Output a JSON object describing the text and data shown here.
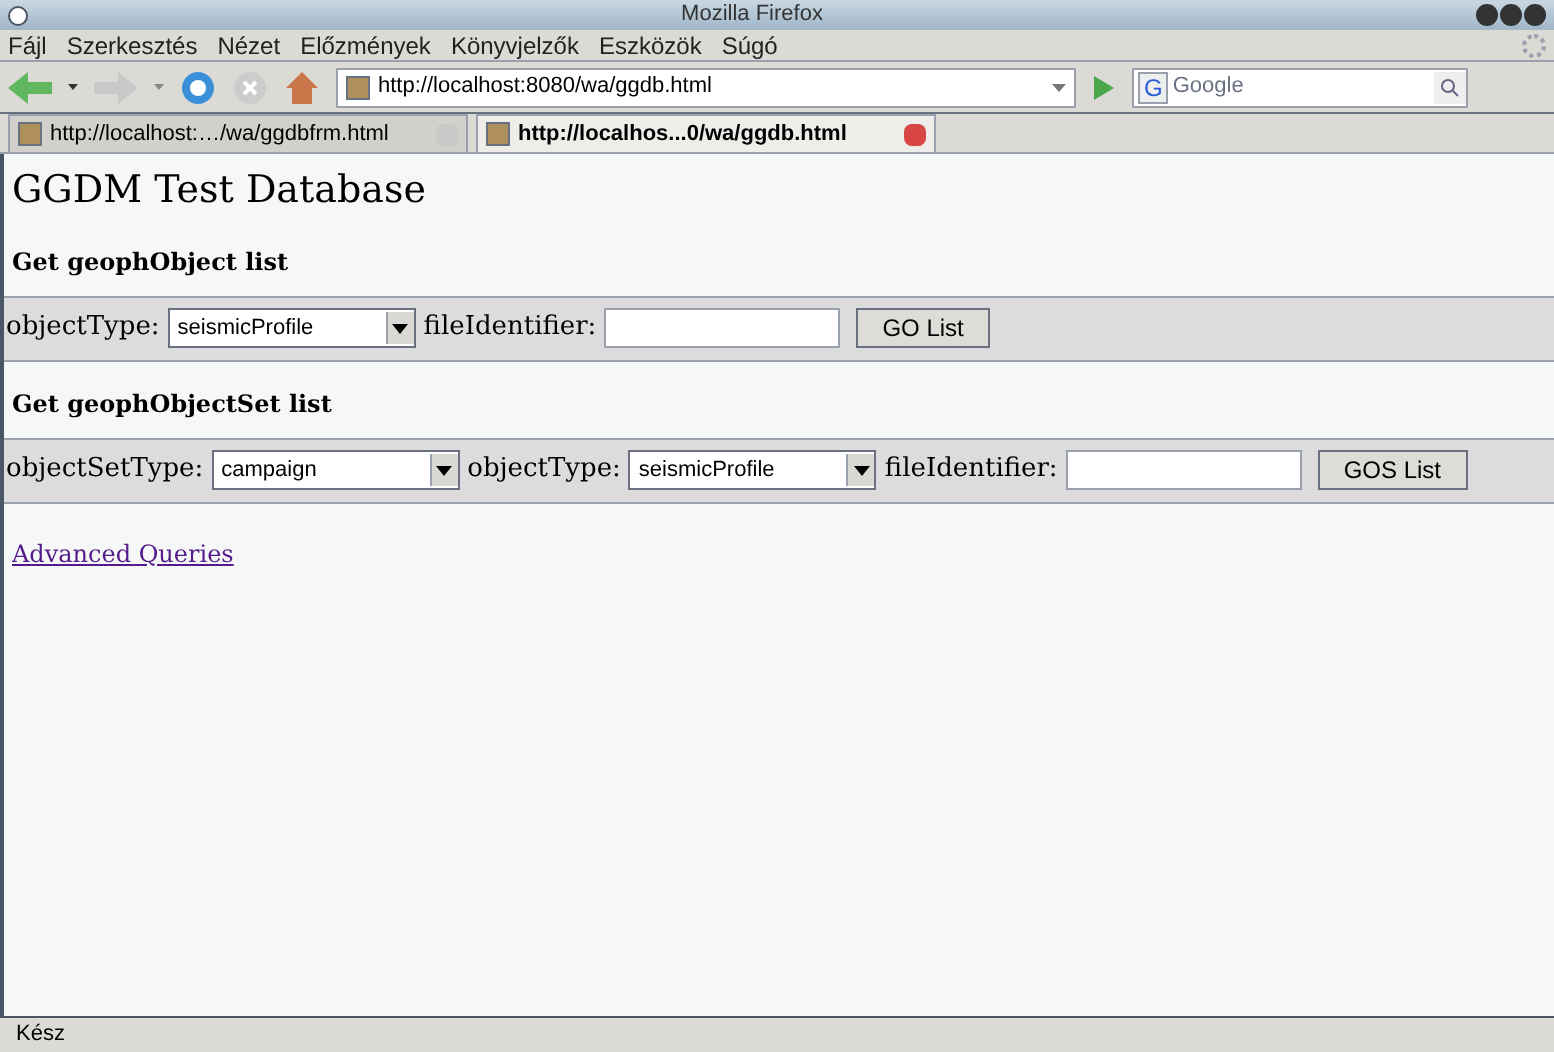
{
  "window": {
    "title": "Mozilla Firefox"
  },
  "menu": [
    "Fájl",
    "Szerkesztés",
    "Nézet",
    "Előzmények",
    "Könyvjelzők",
    "Eszközök",
    "Súgó"
  ],
  "address_bar": {
    "value": "http://localhost:8080/wa/ggdb.html"
  },
  "search": {
    "placeholder": "Google",
    "engine_label": "G"
  },
  "tabs": [
    {
      "label": "http://localhost:…/wa/ggdbfrm.html",
      "selected": false
    },
    {
      "label": "http://localhos...0/wa/ggdb.html",
      "selected": true
    }
  ],
  "page": {
    "title": "GGDM Test Database",
    "sections": [
      {
        "heading": "Get geophObject list",
        "fields": [
          {
            "kind": "select",
            "label": "objectType:",
            "value": "seismicProfile"
          },
          {
            "kind": "input",
            "label": "fileIdentifier:"
          },
          {
            "kind": "button",
            "label": "GO List"
          }
        ]
      },
      {
        "heading": "Get geophObjectSet list",
        "fields": [
          {
            "kind": "select",
            "label": "objectSetType:",
            "value": "campaign"
          },
          {
            "kind": "select",
            "label": "objectType:",
            "value": "seismicProfile"
          },
          {
            "kind": "input",
            "label": "fileIdentifier:"
          },
          {
            "kind": "button",
            "label": "GOS List"
          }
        ]
      }
    ],
    "link": "Advanced Queries"
  },
  "status_bar": {
    "text": "Kész"
  }
}
